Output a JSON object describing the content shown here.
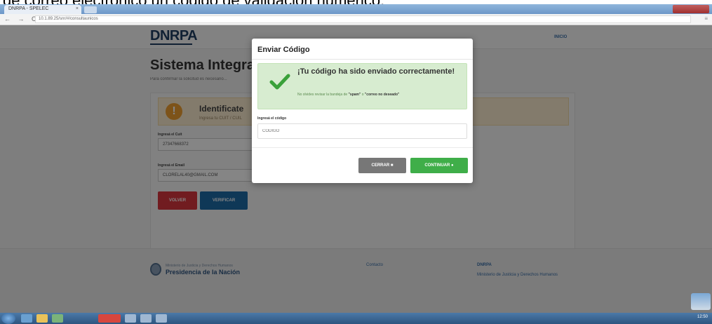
{
  "caption": "de correo electrónico un código de validación numérico.",
  "browser": {
    "tab_title": "DNRPA - SPELEC",
    "tab_close": "×",
    "url": "10.1.89.25/snr/#/consultaunicos",
    "nav_icons": "← → C ⌂"
  },
  "site": {
    "logo": "DNRPA",
    "nav_link": "INICIO",
    "main_title": "Sistema Integral",
    "main_subtitle": "Para confirmar la solicitud es necesario...",
    "alert_icon": "!",
    "alert_title": "Identificate",
    "alert_text": "Ingresa tu CUIT / CUIL",
    "cuit_label": "Ingresá el Cuit",
    "cuit_value": "27347668372",
    "email_label": "Ingresá el Email",
    "email_value": "CLORELAL40@GMAIL.COM",
    "btn_back": "VOLVER",
    "btn_verify": "VERIFICAR"
  },
  "footer": {
    "logo_small": "Ministerio de Justicia y Derechos Humanos",
    "logo_main": "Presidencia de la Nación",
    "contact": "Contacto",
    "org_title": "DNRPA",
    "org_text": "Ministerio de Justicia y Derechos Humanos"
  },
  "modal": {
    "title": "Enviar Código",
    "success_title": "¡Tu código ha sido enviado correctamente!",
    "success_text_pre": "No olvides revisar la bandeja de",
    "spam": "\"spam\"",
    "success_text_mid": "o",
    "unwanted": "\"correo no deseado\"",
    "code_label": "Ingresá el código",
    "code_placeholder": "CÓDIGO",
    "btn_close": "CERRAR ■",
    "btn_continue": "CONTINUAR ●"
  },
  "taskbar": {
    "time": "12:50"
  },
  "colors": {
    "success_bg": "#d7ecd0",
    "check_green": "#3aa13a",
    "continue_green": "#3fae49",
    "close_gray": "#777777",
    "brand_navy": "#1f3f63"
  }
}
